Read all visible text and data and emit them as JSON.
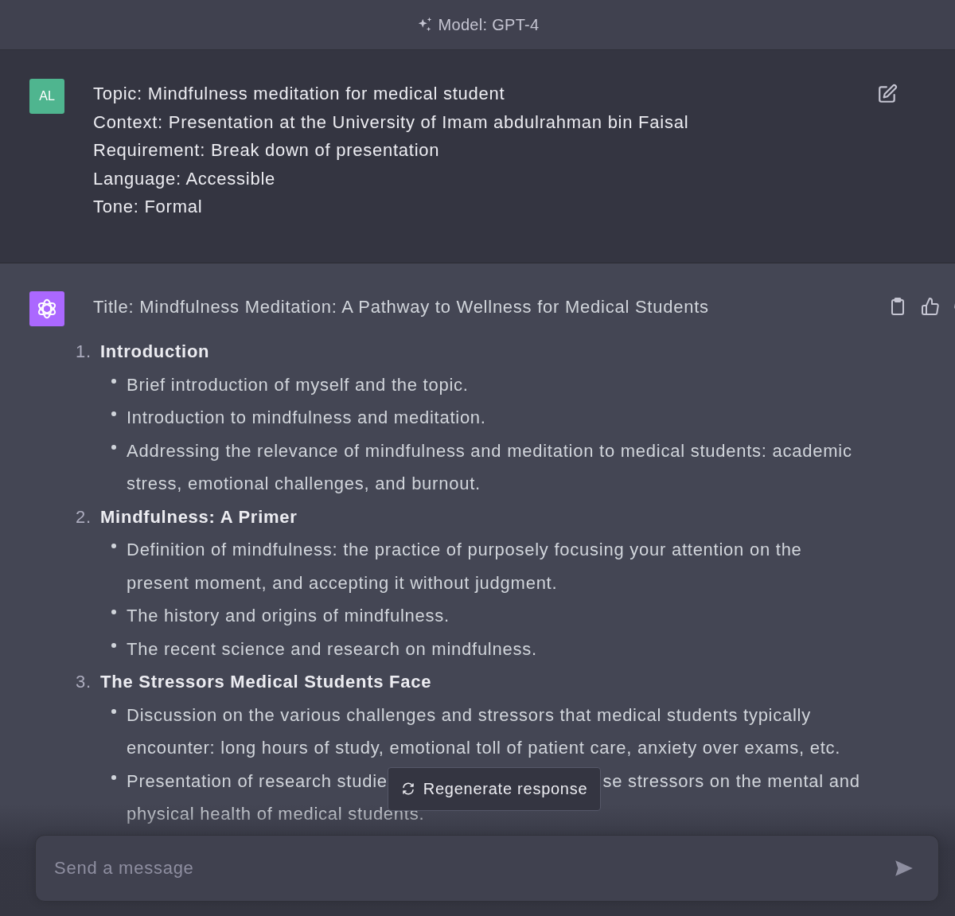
{
  "header": {
    "title": "Model: GPT-4"
  },
  "messages": [
    {
      "kind": "user",
      "avatar": "AL",
      "lines": [
        "Topic: Mindfulness meditation for medical student",
        "Context: Presentation at the University of Imam abdulrahman bin Faisal",
        "Requirement: Break down of presentation",
        "Language: Accessible",
        "Tone: Formal"
      ]
    },
    {
      "kind": "assistant",
      "title": "Title: Mindfulness Meditation: A Pathway to Wellness for Medical Students",
      "sections": [
        {
          "number": "1.",
          "heading": "Introduction",
          "bullets": [
            {
              "kind": "plain",
              "text": "Brief introduction of myself and the topic."
            },
            {
              "kind": "plain",
              "text": "Introduction to mindfulness and meditation."
            },
            {
              "kind": "plain",
              "text": "Addressing the relevance of mindfulness and meditation to medical students: academic stress, emotional challenges, and burnout."
            }
          ]
        },
        {
          "number": "2.",
          "heading": "Mindfulness: A Primer",
          "bullets": [
            {
              "kind": "plain",
              "text": "Definition of mindfulness: the practice of purposely focusing your attention on the present moment, and accepting it without judgment."
            },
            {
              "kind": "plain",
              "text": "The history and origins of mindfulness."
            },
            {
              "kind": "plain",
              "text": "The recent science and research on mindfulness."
            }
          ]
        },
        {
          "number": "3.",
          "heading": "The Stressors Medical Students Face",
          "bullets": [
            {
              "kind": "plain",
              "text": "Discussion on the various challenges and stressors that medical students typically encounter: long hours of study, emotional toll of patient care, anxiety over exams, etc."
            },
            {
              "kind": "covered",
              "before": "Presentation of research studie",
              "after": "se stressors on the mental and",
              "continued": "physical health of medical students."
            }
          ]
        }
      ]
    }
  ],
  "regenerate_button": {
    "label": "Regenerate response"
  },
  "composer": {
    "placeholder": "Send a message"
  }
}
